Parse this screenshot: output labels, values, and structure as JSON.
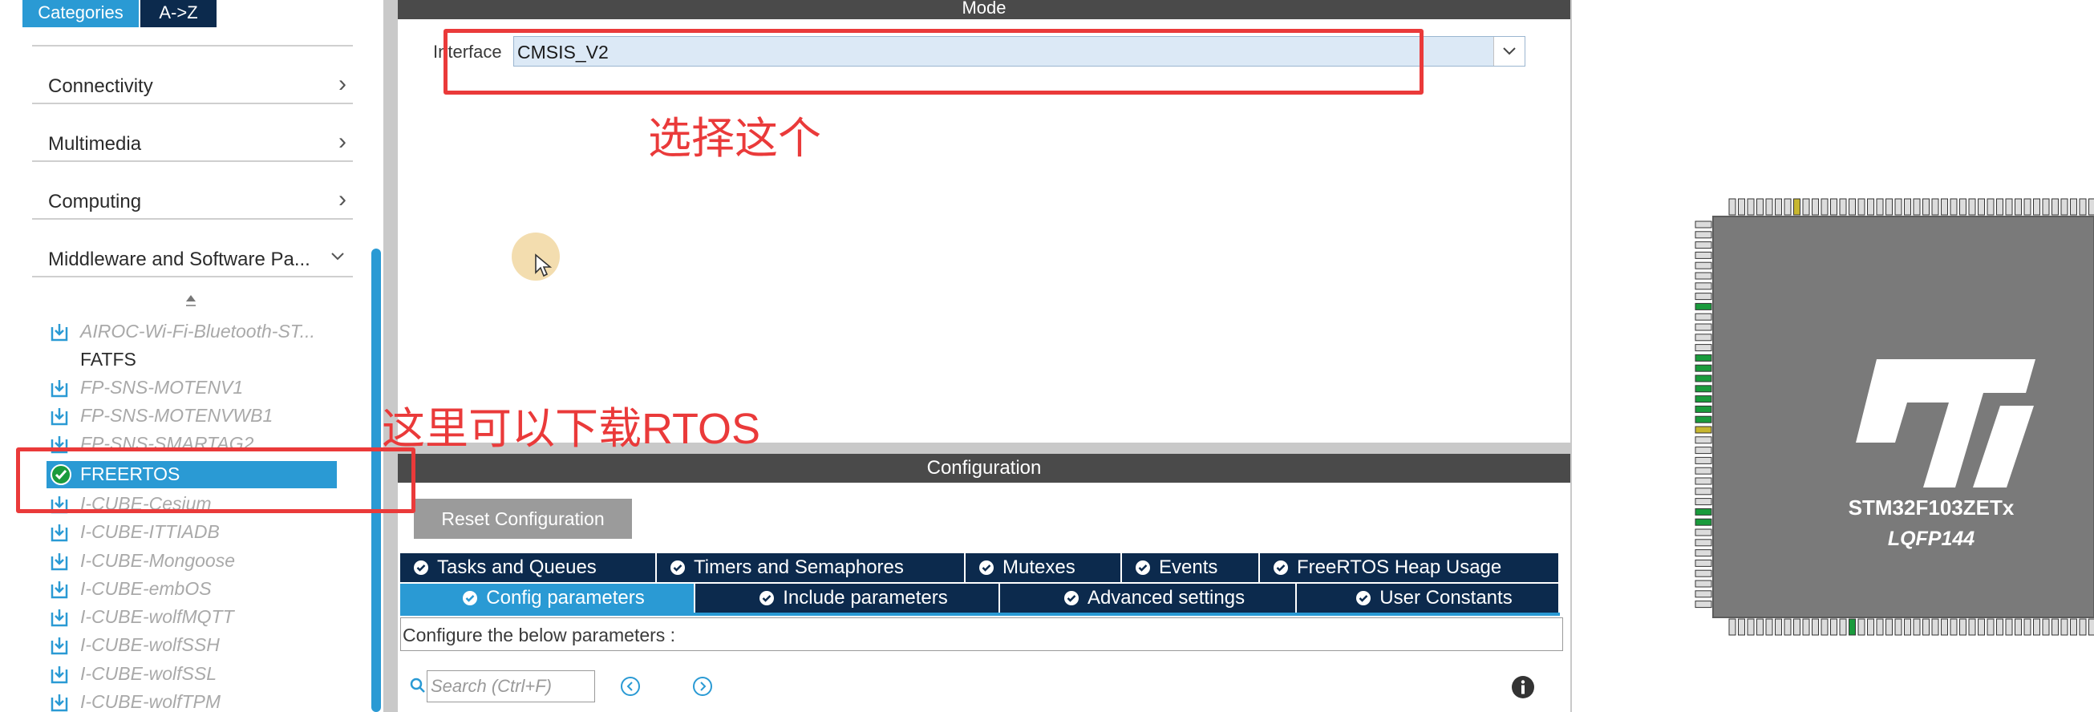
{
  "left": {
    "tabs": [
      {
        "label": "Categories"
      },
      {
        "label": "A->Z"
      }
    ],
    "categories": [
      {
        "label": "Connectivity"
      },
      {
        "label": "Multimedia"
      },
      {
        "label": "Computing"
      },
      {
        "label": "Middleware and Software Pa..."
      }
    ],
    "packages": [
      {
        "label": "AIROC-Wi-Fi-Bluetooth-ST..."
      },
      {
        "label": "FATFS"
      },
      {
        "label": "FP-SNS-MOTENV1"
      },
      {
        "label": "FP-SNS-MOTENVWB1"
      },
      {
        "label": "FP-SNS-SMARTAG2"
      },
      {
        "label": "FREERTOS"
      },
      {
        "label": "I-CUBE-Cesium"
      },
      {
        "label": "I-CUBE-ITTIADB"
      },
      {
        "label": "I-CUBE-Mongoose"
      },
      {
        "label": "I-CUBE-embOS"
      },
      {
        "label": "I-CUBE-wolfMQTT"
      },
      {
        "label": "I-CUBE-wolfSSH"
      },
      {
        "label": "I-CUBE-wolfSSL"
      },
      {
        "label": "I-CUBE-wolfTPM"
      }
    ]
  },
  "mode": {
    "header": "Mode",
    "interface_label": "Interface",
    "interface_value": "CMSIS_V2"
  },
  "config": {
    "header": "Configuration",
    "reset_label": "Reset Configuration",
    "tabs_row1": [
      {
        "label": "Tasks and Queues"
      },
      {
        "label": "Timers and Semaphores"
      },
      {
        "label": "Mutexes"
      },
      {
        "label": "Events"
      },
      {
        "label": "FreeRTOS Heap Usage"
      }
    ],
    "tabs_row2": [
      {
        "label": "Config parameters"
      },
      {
        "label": "Include parameters"
      },
      {
        "label": "Advanced settings"
      },
      {
        "label": "User Constants"
      }
    ],
    "description": "Configure the below parameters :",
    "search_placeholder": "Search (Ctrl+F)"
  },
  "annotations": {
    "select_this": "选择这个",
    "download_here": "这里可以下载RTOS"
  },
  "chip": {
    "part_number": "STM32F103ZETx",
    "package": "LQFP144",
    "logo": "ST"
  },
  "colors": {
    "accent": "#2a9ad4",
    "dark_tab": "#0c2a4d",
    "annotation": "#ea3a3a",
    "pin_green": "#1a9b3c",
    "pin_yellow": "#c7b62f"
  }
}
